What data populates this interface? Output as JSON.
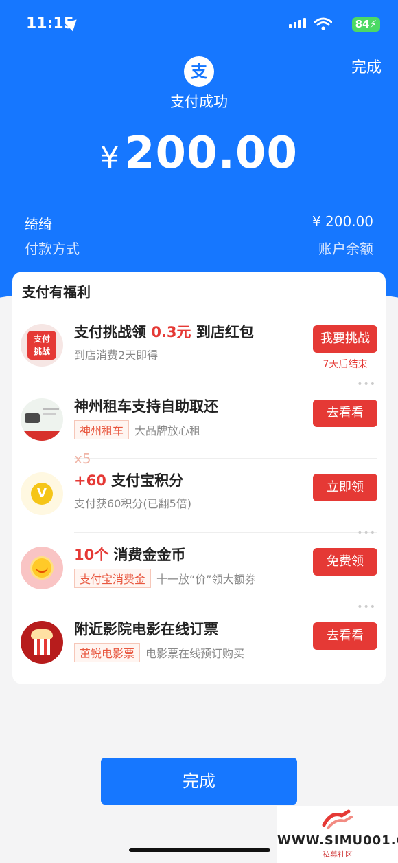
{
  "status_bar": {
    "time": "11:15",
    "battery": "84"
  },
  "header": {
    "done_label": "完成",
    "logo_char": "支",
    "success_text": "支付成功",
    "currency": "¥",
    "amount": "200.00"
  },
  "details": {
    "payee": "绮绮",
    "amount_text": "¥ 200.00",
    "method_label": "付款方式",
    "method_value": "账户余额"
  },
  "benefits": {
    "title": "支付有福利",
    "items": [
      {
        "title_pre": "支付挑战领 ",
        "title_red": "0.3元",
        "title_post": " 到店红包",
        "sub": "到店消费2天即得",
        "button": "我要挑战",
        "note": "7天后结束",
        "icon_text": "支付\n挑战"
      },
      {
        "title": "神州租车支持自助取还",
        "tag": "神州租车",
        "sub": "大品牌放心租",
        "button": "去看看"
      },
      {
        "badge": "x5",
        "title_red": "+60",
        "title_post": "  支付宝积分",
        "sub": "支付获60积分(已翻5倍)",
        "button": "立即领"
      },
      {
        "title_red": "10个",
        "title_post": "  消费金金币",
        "tag": "支付宝消费金",
        "sub": "十一放“价”领大额券",
        "button": "免费领"
      },
      {
        "title": "附近影院电影在线订票",
        "tag": "茁锐电影票",
        "sub": "电影票在线预订购买",
        "button": "去看看"
      }
    ]
  },
  "footer": {
    "done_button": "完成"
  },
  "watermark": {
    "url": "WWW.SIMU001.CN",
    "sub": "私募社区"
  },
  "colors": {
    "brand_blue": "#1677ff",
    "accent_red": "#e53935"
  }
}
